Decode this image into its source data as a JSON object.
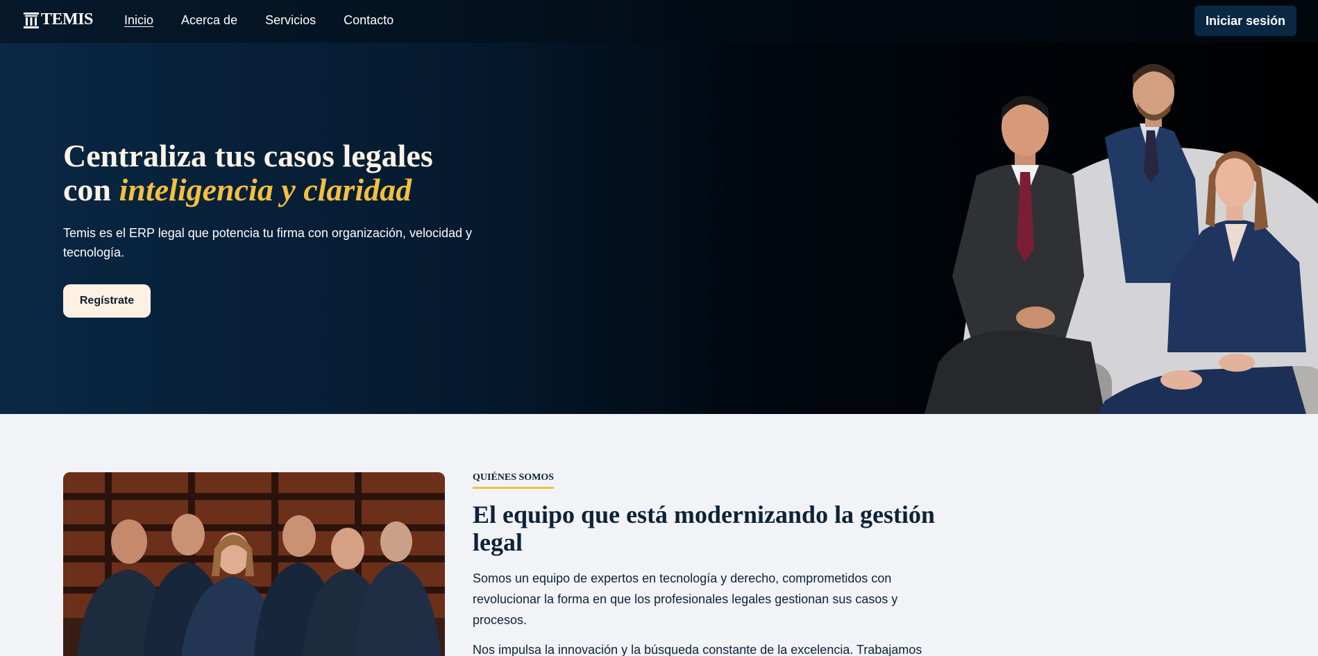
{
  "brand": {
    "name": "TEMIS"
  },
  "nav": {
    "links": [
      "Inicio",
      "Acerca de",
      "Servicios",
      "Contacto"
    ],
    "active": "Inicio",
    "login_label": "Iniciar sesión"
  },
  "hero": {
    "title_line1": "Centraliza tus casos legales",
    "title_prefix": "con ",
    "title_accent": "inteligencia y claridad",
    "subtitle": "Temis es el ERP legal que potencia tu firma con organización, velocidad y tecnología.",
    "cta_label": "Regístrate"
  },
  "about": {
    "kicker": "QUIÉNES SOMOS",
    "title": "El equipo que está modernizando la gestión legal",
    "paragraph1": "Somos un equipo de expertos en tecnología y derecho, comprometidos con revolucionar la forma en que los profesionales legales gestionan sus casos y procesos.",
    "paragraph2": "Nos impulsa la innovación y la búsqueda constante de la excelencia. Trabajamos"
  },
  "colors": {
    "navy": "#0a2744",
    "accent_gold": "#f4bf40",
    "cream": "#fdf1e3",
    "page_bg": "#f1f3f6"
  }
}
